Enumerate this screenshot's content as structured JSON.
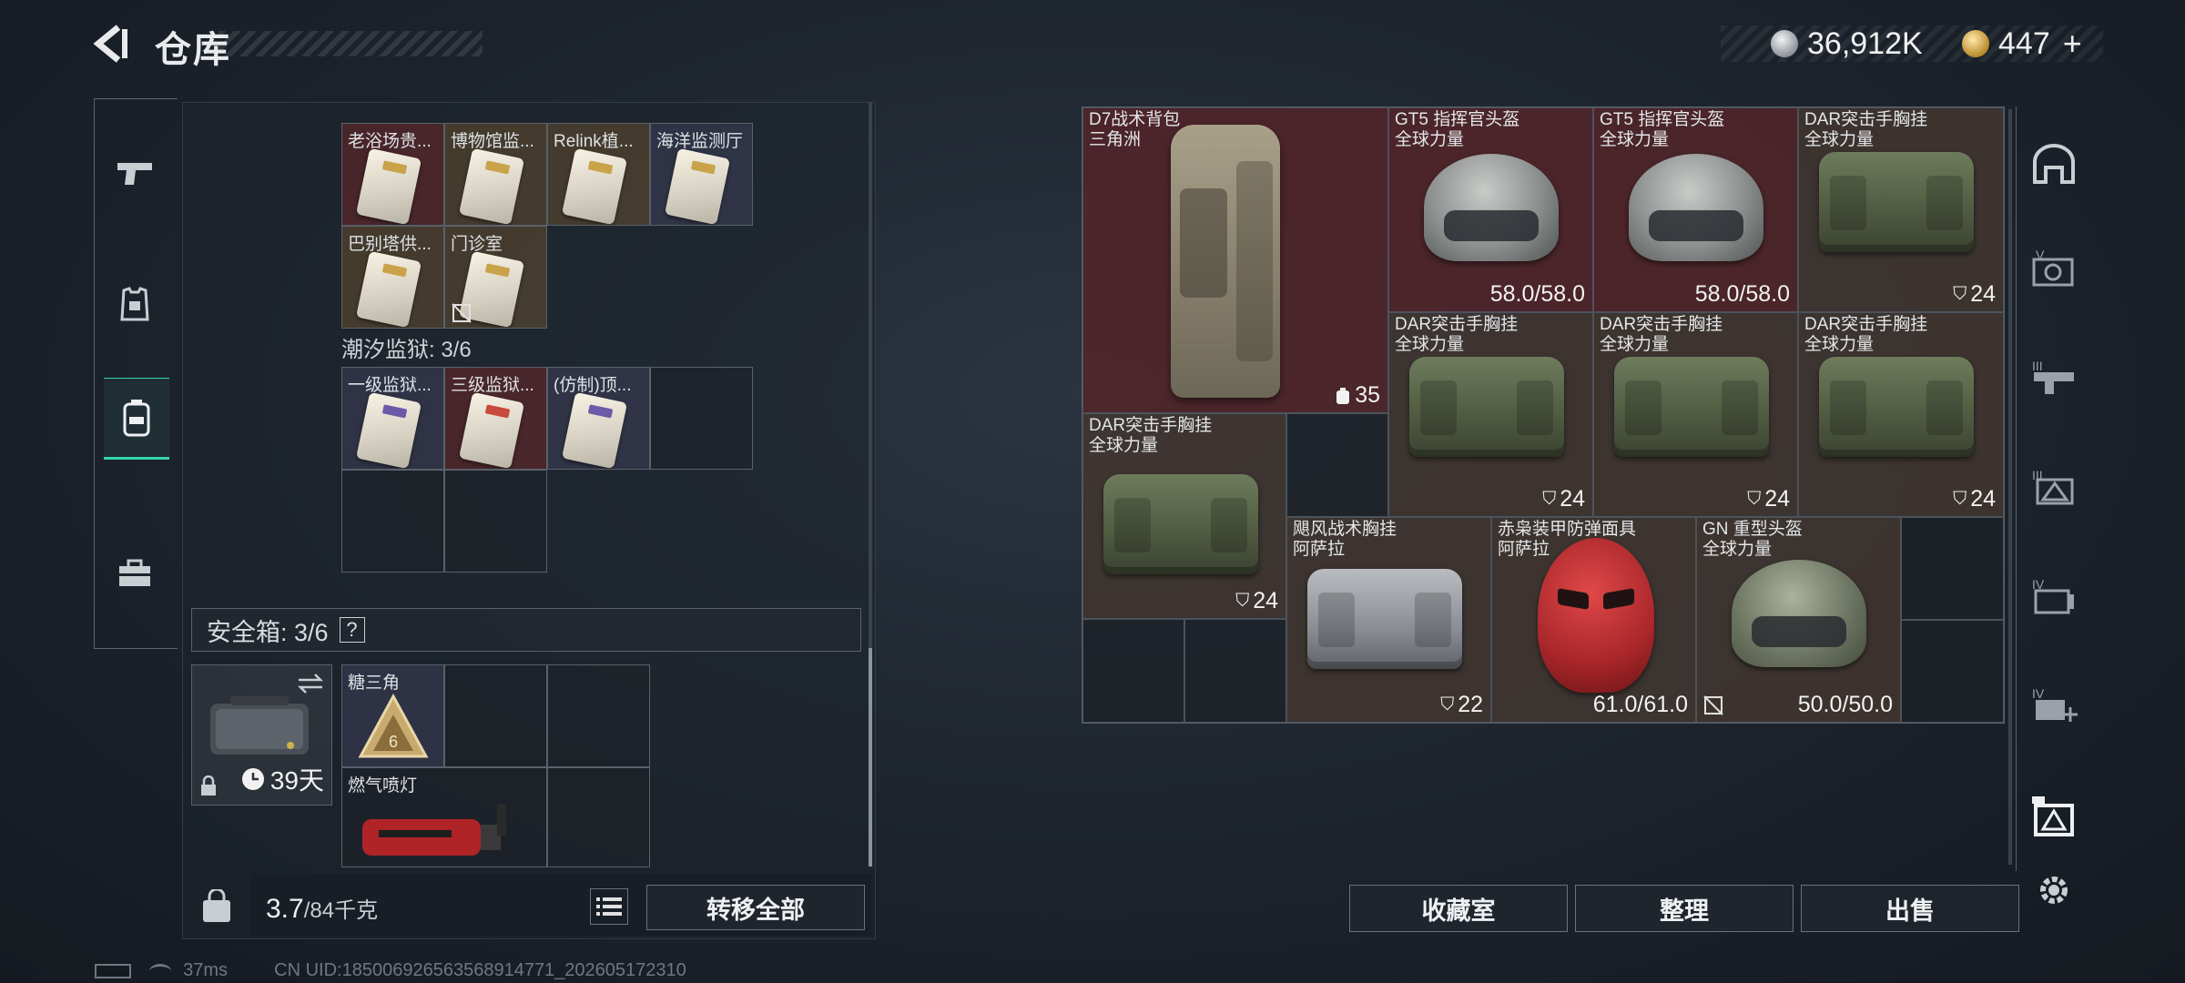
{
  "header": {
    "title": "仓库",
    "currency_silver": "36,912K",
    "currency_gold": "447",
    "gold_plus": "+"
  },
  "left_rail": {
    "items": [
      {
        "name": "weapons",
        "icon": "pistol-icon"
      },
      {
        "name": "armor",
        "icon": "armor-icon"
      },
      {
        "name": "backpack",
        "icon": "backpack-icon",
        "active": true
      },
      {
        "name": "kit",
        "icon": "briefcase-icon"
      }
    ]
  },
  "left_panel": {
    "keys_row1": [
      "老浴场贵...",
      "博物馆监...",
      "Relink植...",
      "海洋监测厅"
    ],
    "keys_row2": [
      "巴别塔供...",
      "门诊室"
    ],
    "section_tide_prison": "潮汐监狱: 3/6",
    "prison_keys": [
      "一级监狱...",
      "三级监狱...",
      "(仿制)顶..."
    ],
    "safe_box_label": "安全箱: 3/6",
    "safe_help": "?",
    "safe_days": "39天",
    "safe_items": [
      {
        "name": "糖三角"
      },
      {
        "name": "燃气喷灯"
      }
    ],
    "weight_current": "3.7",
    "weight_max": "/84千克",
    "transfer_all": "转移全部",
    "status_ping": "37ms",
    "status_uid": "CN UID:185006926563568914771_202605172310"
  },
  "right_panel": {
    "items": [
      {
        "id": "d7",
        "name": "D7战术背包",
        "sub": "三角洲",
        "value": "35"
      },
      {
        "id": "gt5a",
        "name": "GT5 指挥官头盔",
        "sub": "全球力量",
        "value": "58.0/58.0"
      },
      {
        "id": "gt5b",
        "name": "GT5 指挥官头盔",
        "sub": "全球力量",
        "value": "58.0/58.0"
      },
      {
        "id": "dar1",
        "name": "DAR突击手胸挂",
        "sub": "全球力量",
        "value": "24"
      },
      {
        "id": "dar2",
        "name": "DAR突击手胸挂",
        "sub": "全球力量",
        "value": "24"
      },
      {
        "id": "dar3",
        "name": "DAR突击手胸挂",
        "sub": "全球力量",
        "value": "24"
      },
      {
        "id": "dar4",
        "name": "DAR突击手胸挂",
        "sub": "全球力量",
        "value": "24"
      },
      {
        "id": "dar5",
        "name": "DAR突击手胸挂",
        "sub": "全球力量",
        "value": "24"
      },
      {
        "id": "jufeng",
        "name": "飓风战术胸挂",
        "sub": "阿萨拉",
        "value": "22"
      },
      {
        "id": "chixiao",
        "name": "赤枭装甲防弹面具",
        "sub": "阿萨拉",
        "value": "61.0/61.0"
      },
      {
        "id": "gn",
        "name": "GN 重型头盔",
        "sub": "全球力量",
        "value": "50.0/50.0"
      }
    ],
    "btn_collection": "收藏室",
    "btn_sort": "整理",
    "btn_sell": "出售"
  },
  "colors": {
    "accent_active": "#35d6a8",
    "cell_red": "#5c262a",
    "cell_brown": "#483a32"
  }
}
